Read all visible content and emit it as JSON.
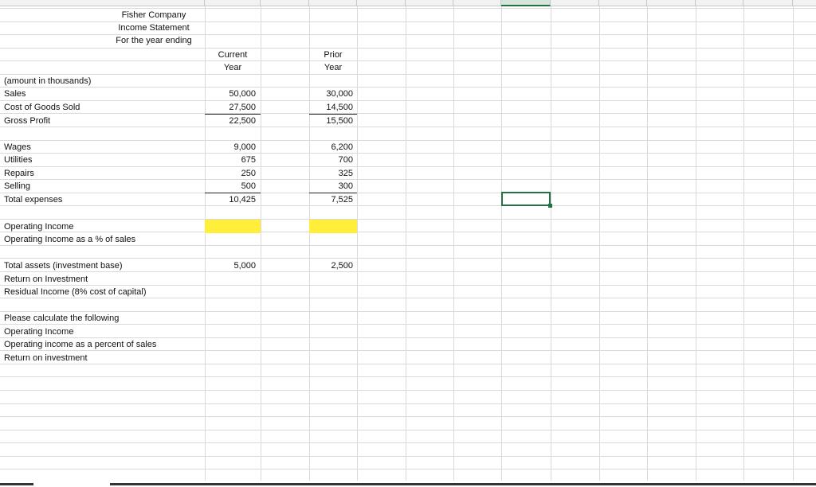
{
  "title": {
    "company": "Fisher Company",
    "statement": "Income Statement",
    "period": "For the year ending"
  },
  "columns": {
    "current_line1": "Current",
    "current_line2": "Year",
    "prior_line1": "Prior",
    "prior_line2": "Year"
  },
  "note": "(amount in thousands)",
  "rows": {
    "sales": {
      "label": "Sales",
      "current": "50,000",
      "prior": "30,000"
    },
    "cogs": {
      "label": "Cost of Goods Sold",
      "current": "27,500",
      "prior": "14,500"
    },
    "gross": {
      "label": "Gross Profit",
      "current": "22,500",
      "prior": "15,500"
    },
    "wages": {
      "label": "Wages",
      "current": "9,000",
      "prior": "6,200"
    },
    "utilities": {
      "label": "Utilities",
      "current": "675",
      "prior": "700"
    },
    "repairs": {
      "label": "Repairs",
      "current": "250",
      "prior": "325"
    },
    "selling": {
      "label": "Selling",
      "current": "500",
      "prior": "300"
    },
    "total_expenses": {
      "label": "Total expenses",
      "current": "10,425",
      "prior": "7,525"
    },
    "operating_income": {
      "label": "Operating Income",
      "current": "",
      "prior": ""
    },
    "oi_pct_sales": {
      "label": "Operating Income as a % of sales"
    },
    "total_assets": {
      "label": "Total assets (investment base)",
      "current": "5,000",
      "prior": "2,500"
    },
    "roi": {
      "label": "Return on Investment"
    },
    "residual_income": {
      "label": "Residual Income (8% cost of capital)"
    }
  },
  "instructions": {
    "heading": "Please calculate the following",
    "item1": "Operating Income",
    "item2": "Operating income as a percent of sales",
    "item3": "Return on investment"
  },
  "colors": {
    "highlight": "#ffef3a",
    "selection": "#217346",
    "gridline": "#dadada"
  }
}
